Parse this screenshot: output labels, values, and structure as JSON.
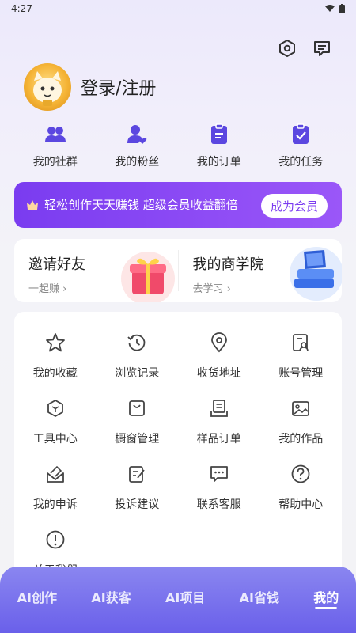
{
  "status": {
    "time": "4:27"
  },
  "colors": {
    "accent": "#7b3cf0",
    "tabbar": "#6a60ea"
  },
  "header": {
    "icons": [
      "settings-hex-icon",
      "message-icon"
    ]
  },
  "profile": {
    "login_label": "登录/注册"
  },
  "quick": [
    {
      "label": "我的社群",
      "icon": "community-icon"
    },
    {
      "label": "我的粉丝",
      "icon": "fans-icon"
    },
    {
      "label": "我的订单",
      "icon": "orders-icon"
    },
    {
      "label": "我的任务",
      "icon": "tasks-icon"
    }
  ],
  "vip": {
    "text": "轻松创作天天赚钱  超级会员收益翻倍",
    "button": "成为会员"
  },
  "promo": {
    "left": {
      "title": "邀请好友",
      "sub": "一起赚"
    },
    "right": {
      "title": "我的商学院",
      "sub": "去学习"
    }
  },
  "grid": [
    {
      "label": "我的收藏"
    },
    {
      "label": "浏览记录"
    },
    {
      "label": "收货地址"
    },
    {
      "label": "账号管理"
    },
    {
      "label": "工具中心"
    },
    {
      "label": "橱窗管理"
    },
    {
      "label": "样品订单"
    },
    {
      "label": "我的作品"
    },
    {
      "label": "我的申诉"
    },
    {
      "label": "投诉建议"
    },
    {
      "label": "联系客服"
    },
    {
      "label": "帮助中心"
    },
    {
      "label": "关于我们"
    }
  ],
  "tabs": [
    "AI创作",
    "AI获客",
    "AI项目",
    "AI省钱",
    "我的"
  ]
}
